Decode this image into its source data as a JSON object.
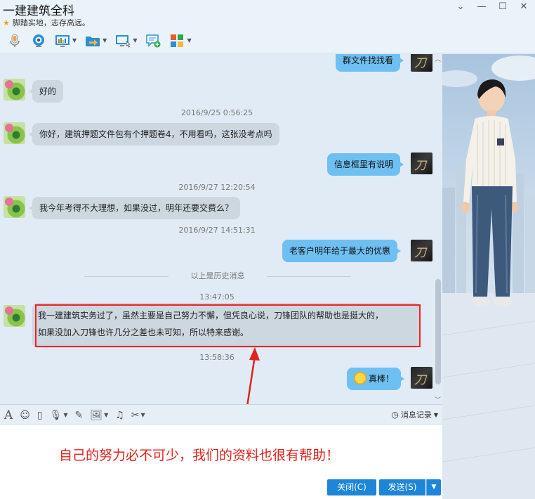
{
  "window": {
    "title": "一建建筑全科",
    "subtitle": "脚踏实地，志存高远。"
  },
  "toolbar": {
    "items": [
      {
        "icon": "microphone-icon"
      },
      {
        "icon": "webcam-icon"
      },
      {
        "icon": "app-board-icon",
        "has_menu": true
      },
      {
        "icon": "file-transfer-icon",
        "has_menu": true
      },
      {
        "icon": "screen-share-icon",
        "has_menu": true
      },
      {
        "icon": "new-chat-icon"
      },
      {
        "icon": "apps-grid-icon",
        "has_menu": true
      }
    ]
  },
  "messages": {
    "m0": "群文件找找看",
    "m1": "好的",
    "ts1": "2016/9/25 0:56:25",
    "m2": "你好，建筑押题文件包有个押题卷4，不用看吗，这张没考点吗",
    "m3": "信息框里有说明",
    "ts2": "2016/9/27 12:20:54",
    "m4": "我今年考得不大理想，如果没过，明年还要交费么？",
    "ts3": "2016/9/27 14:51:31",
    "m5": "老客户明年给于最大的优惠",
    "divider": "以上是历史消息",
    "ts4": "13:47:05",
    "m6_line1": "我一建建筑实务过了，虽然主要是自己努力不懈，但凭良心说，刀锋团队的帮助也是挺大的，",
    "m6_line2": "如果没加入刀锋也许几分之差也未可知，所以特来感谢。",
    "ts5": "13:58:36",
    "m7": "真棒！"
  },
  "input_toolbar": {
    "history_label": "消息记录"
  },
  "annotation": "自己的努力必不可少，我们的资料也很有帮助！",
  "buttons": {
    "close": "关闭(C)",
    "send": "发送(S)"
  },
  "colors": {
    "accent": "#1d86d8",
    "bubble_self": "#6ec0f2",
    "bubble_other": "#ccd7e0",
    "highlight": "#e22222"
  }
}
